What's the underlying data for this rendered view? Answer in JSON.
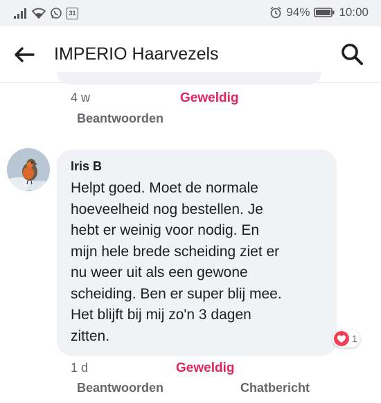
{
  "status_bar": {
    "calendar_day": "31",
    "battery": "94%",
    "clock": "10:00"
  },
  "header": {
    "title": "IMPERIO Haarvezels"
  },
  "previous_comment": {
    "time": "4 w",
    "react_label": "Geweldig",
    "reply_label": "Beantwoorden"
  },
  "comment": {
    "author": "Iris B",
    "text_lines": [
      "Helpt goed. Moet de normale",
      "hoeveelheid nog bestellen. Je",
      "hebt er weinig voor nodig. En",
      "mijn hele brede scheiding ziet er",
      "nu weer uit als een gewone",
      "scheiding. Ben er super blij mee.",
      "Het blijft bij mij zo'n 3 dagen",
      "zitten."
    ],
    "reaction_count": "1",
    "time": "1 d",
    "react_label": "Geweldig",
    "reply_label": "Beantwoorden",
    "message_label": "Chatbericht"
  },
  "colors": {
    "accent_reaction": "#e0245e",
    "bubble_bg": "#f0f2f5",
    "secondary_text": "#65676b"
  },
  "icons": [
    "signal-icon",
    "wifi-icon",
    "whatsapp-icon",
    "calendar-icon",
    "alarm-icon",
    "battery-icon",
    "back-arrow-icon",
    "search-icon",
    "heart-icon",
    "avatar-robin"
  ]
}
